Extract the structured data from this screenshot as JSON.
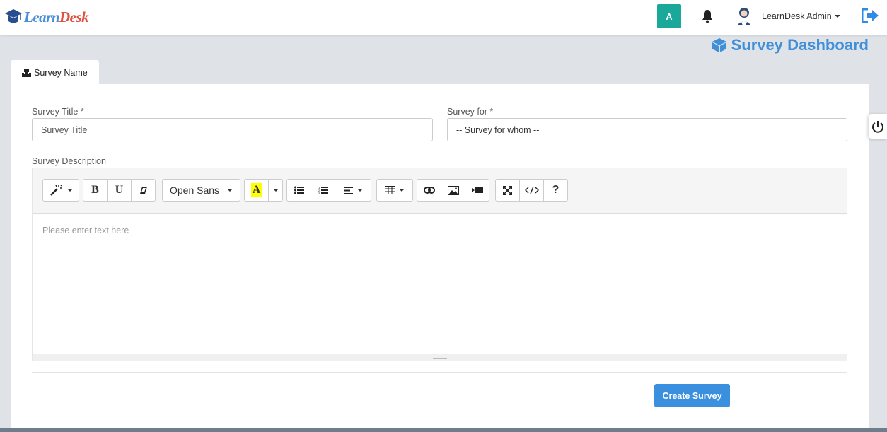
{
  "header": {
    "logo": {
      "part1": "Learn",
      "part2": "Desk"
    },
    "avatar_initial": "A",
    "user_name": "LearnDesk Admin"
  },
  "page": {
    "title": "Survey Dashboard",
    "tab_label": "Survey Name"
  },
  "form": {
    "survey_title_label": "Survey Title *",
    "survey_title_placeholder": "Survey Title",
    "survey_for_label": "Survey for *",
    "survey_for_selected": "-- Survey for whom --",
    "description_label": "Survey Description",
    "editor_placeholder": "Please enter text here",
    "font_name": "Open Sans",
    "submit_label": "Create Survey"
  },
  "toolbar": {
    "bold": "B",
    "underline": "U",
    "color_letter": "A",
    "help": "?"
  },
  "colors": {
    "accent": "#3a8fde",
    "title": "#3f8fd9",
    "avatar_bg": "#1aa89a",
    "highlight": "#ffff00"
  }
}
